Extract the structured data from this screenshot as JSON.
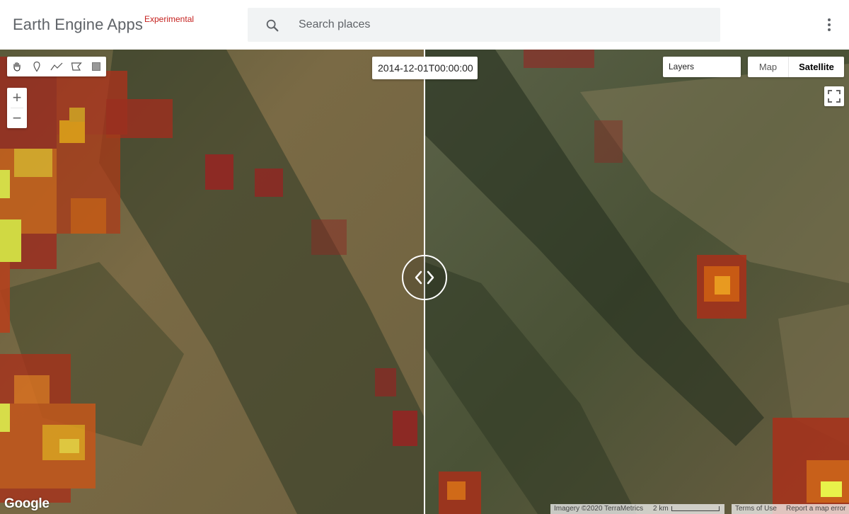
{
  "header": {
    "title": "Earth Engine Apps",
    "badge": "Experimental",
    "search_placeholder": "Search places",
    "search_value": ""
  },
  "map": {
    "date_label": "2014-12-01T00:00:00",
    "layers_label": "Layers",
    "map_type_options": [
      "Map",
      "Satellite"
    ],
    "map_type_selected": "Satellite",
    "zoom_in": "+",
    "zoom_out": "−",
    "logo": "Google",
    "attribution": "Imagery ©2020 TerraMetrics",
    "scale_label": "2 km",
    "terms_label": "Terms of Use",
    "report_label": "Report a map error"
  },
  "draw_tools": [
    {
      "icon": "hand-icon",
      "label": "pan"
    },
    {
      "icon": "marker-icon",
      "label": "point"
    },
    {
      "icon": "line-icon",
      "label": "line"
    },
    {
      "icon": "polygon-icon",
      "label": "polygon"
    },
    {
      "icon": "rectangle-icon",
      "label": "rectangle"
    }
  ],
  "colors": {
    "badge": "#c5221f",
    "header_text": "#5f6368",
    "search_bg": "#f1f3f4",
    "heat_low": "#8b1a1a",
    "heat_mid": "#d2691e",
    "heat_high": "#e8f24a"
  }
}
